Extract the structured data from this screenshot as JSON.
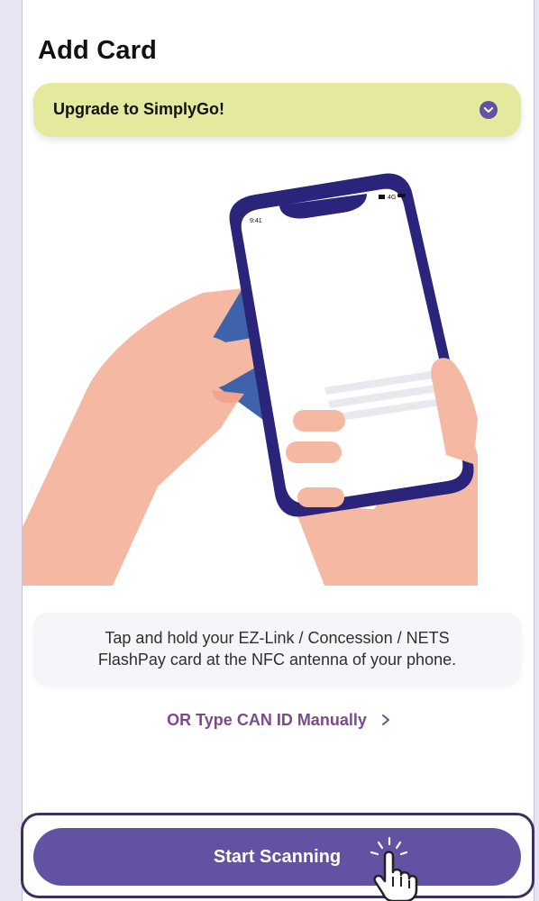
{
  "page": {
    "title": "Add Card"
  },
  "banner": {
    "label": "Upgrade to SimplyGo!",
    "icon": "chevron-down-circle-icon"
  },
  "illustration": {
    "phone_time": "9:41",
    "phone_network": "4G"
  },
  "instruction": {
    "text_line1": "Tap and hold your EZ-Link / Concession / NETS",
    "text_line2": "FlashPay card at the NFC antenna of your phone."
  },
  "manual_entry": {
    "label": "OR Type CAN ID Manually",
    "icon": "chevron-right-icon"
  },
  "primary_action": {
    "label": "Start Scanning"
  },
  "colors": {
    "accent": "#6352a3",
    "banner_bg": "#e4e99d",
    "link": "#7a4b8c",
    "card_blue": "#3f63aa",
    "phone_frame": "#2a257a",
    "skin": "#f5b9a3"
  }
}
